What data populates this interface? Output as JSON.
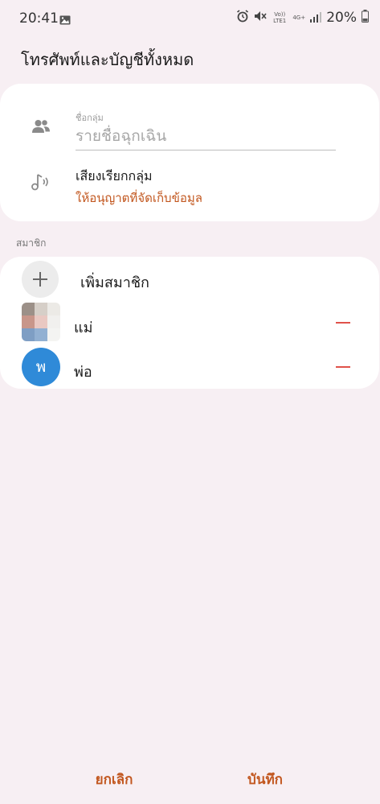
{
  "status_bar": {
    "time": "20:41",
    "battery_percent": "20%",
    "network_volte": "Vo)) LTE1",
    "network_type": "4G+",
    "icons": [
      "image-icon",
      "alarm-icon",
      "mute-icon",
      "signal-icon",
      "battery-icon"
    ]
  },
  "header": {
    "title": "โทรศัพท์และบัญชีทั้งหมด"
  },
  "group_card": {
    "name_label": "ชื่อกลุ่ม",
    "name_value": "รายชื่อฉุกเฉิน",
    "ringtone_title": "เสียงเรียกกลุ่ม",
    "ringtone_subtitle": "ให้อนุญาตที่จัดเก็บข้อมูล"
  },
  "members_section": {
    "label": "สมาชิก",
    "add_label": "เพิ่มสมาชิก",
    "members": [
      {
        "name": "แม่",
        "avatar": "photo"
      },
      {
        "name": "พ่อ",
        "avatar": "พ"
      }
    ]
  },
  "footer": {
    "cancel_label": "ยกเลิก",
    "save_label": "บันทึก"
  },
  "colors": {
    "background": "#f7eff3",
    "card": "#ffffff",
    "accent": "#c2571f",
    "remove": "#e0524a",
    "avatar_blue": "#2f8ad8"
  }
}
